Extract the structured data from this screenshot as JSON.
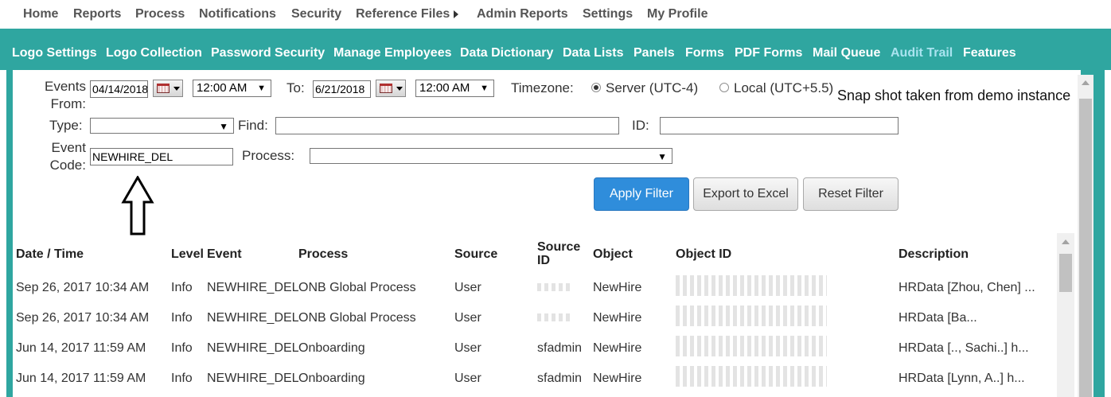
{
  "top_nav": [
    "Home",
    "Reports",
    "Process",
    "Notifications",
    "Security",
    "Reference Files",
    "Admin Reports",
    "Settings",
    "My Profile"
  ],
  "sub_nav": [
    "Logo Settings",
    "Logo Collection",
    "Password Security",
    "Manage Employees",
    "Data Dictionary",
    "Data Lists",
    "Panels",
    "Forms",
    "PDF Forms",
    "Mail Queue",
    "Audit Trail",
    "Features"
  ],
  "active_sub_nav": "Audit Trail",
  "filters": {
    "events_from_label_1": "Events",
    "events_from_label_2": "From:",
    "from_date": "04/14/2018",
    "from_time": "12:00 AM",
    "to_label": "To:",
    "to_date": "6/21/2018",
    "to_time": "12:00 AM",
    "timezone_label": "Timezone:",
    "tz_server": "Server (UTC-4)",
    "tz_local": "Local (UTC+5.5)",
    "type_label": "Type:",
    "type_value": "",
    "find_label": "Find:",
    "find_value": "",
    "id_label": "ID:",
    "id_value": "",
    "event_code_label_1": "Event",
    "event_code_label_2": "Code:",
    "event_code_value": "NEWHIRE_DEL",
    "process_label": "Process:",
    "process_value": ""
  },
  "buttons": {
    "apply": "Apply Filter",
    "export": "Export to Excel",
    "reset": "Reset Filter"
  },
  "annotation": "Snap shot taken from demo instance",
  "table": {
    "headers": {
      "datetime": "Date / Time",
      "level": "Level",
      "event": "Event",
      "process": "Process",
      "source": "Source",
      "source_id_1": "Source",
      "source_id_2": "ID",
      "object": "Object",
      "object_id": "Object ID",
      "description": "Description"
    },
    "rows": [
      {
        "datetime": "Sep 26, 2017 10:34 AM",
        "level": "Info",
        "event": "NEWHIRE_DEL",
        "process": "ONB Global Process",
        "source": "User",
        "source_id": "",
        "object": "NewHire",
        "object_id": "",
        "description": "HRData [Zhou, Chen] ..."
      },
      {
        "datetime": "Sep 26, 2017 10:34 AM",
        "level": "Info",
        "event": "NEWHIRE_DEL",
        "process": "ONB Global Process",
        "source": "User",
        "source_id": "",
        "object": "NewHire",
        "object_id": "",
        "description": "HRData [Ba..."
      },
      {
        "datetime": "Jun 14, 2017 11:59 AM",
        "level": "Info",
        "event": "NEWHIRE_DEL",
        "process": "Onboarding",
        "source": "User",
        "source_id": "sfadmin",
        "object": "NewHire",
        "object_id": "",
        "description": "HRData [.., Sachi..] h..."
      },
      {
        "datetime": "Jun 14, 2017 11:59 AM",
        "level": "Info",
        "event": "NEWHIRE_DEL",
        "process": "Onboarding",
        "source": "User",
        "source_id": "sfadmin",
        "object": "NewHire",
        "object_id": "",
        "description": "HRData [Lynn, A..] h..."
      }
    ]
  }
}
